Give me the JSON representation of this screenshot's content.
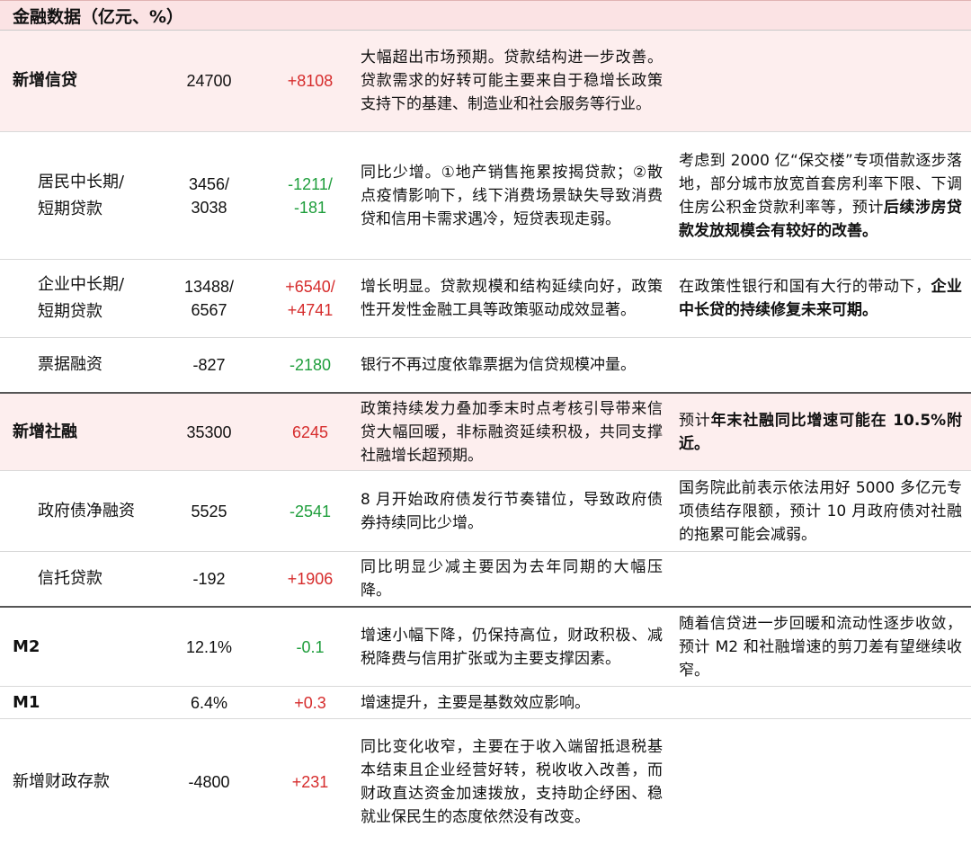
{
  "header": {
    "title": "金融数据（亿元、%）"
  },
  "rows": [
    {
      "name": "新增信贷",
      "value": "24700",
      "change": "+8108",
      "desc": "大幅超出市场预期。贷款结构进一步改善。贷款需求的好转可能主要来自于稳增长政策支持下的基建、制造业和社会服务等行业。",
      "outlook_pre": "",
      "outlook_bold": "",
      "outlook_post": ""
    },
    {
      "name": "居民中长期/短期贷款",
      "value": "3456/3038",
      "change": "-1211/-181",
      "desc": "同比少增。①地产销售拖累按揭贷款；②散点疫情影响下，线下消费场景缺失导致消费贷和信用卡需求遇冷，短贷表现走弱。",
      "outlook_pre": "考虑到 2000 亿“保交楼”专项借款逐步落地，部分城市放宽首套房利率下限、下调住房公积金贷款利率等，预计",
      "outlook_bold": "后续涉房贷款发放规模会有较好的改善。",
      "outlook_post": ""
    },
    {
      "name": "企业中长期/短期贷款",
      "value": "13488/6567",
      "change": "+6540/+4741",
      "desc": "增长明显。贷款规模和结构延续向好，政策性开发性金融工具等政策驱动成效显著。",
      "outlook_pre": "在政策性银行和国有大行的带动下，",
      "outlook_bold": "企业中长贷的持续修复未来可期。",
      "outlook_post": ""
    },
    {
      "name": "票据融资",
      "value": "-827",
      "change": "-2180",
      "desc": "银行不再过度依靠票据为信贷规模冲量。",
      "outlook_pre": "",
      "outlook_bold": "",
      "outlook_post": ""
    },
    {
      "name": "新增社融",
      "value": "35300",
      "change": "6245",
      "desc": "政策持续发力叠加季末时点考核引导带来信贷大幅回暖，非标融资延续积极，共同支撑社融增长超预期。",
      "outlook_pre": "预计",
      "outlook_bold": "年末社融同比增速可能在 10.5%附近。",
      "outlook_post": ""
    },
    {
      "name": "政府债净融资",
      "value": "5525",
      "change": "-2541",
      "desc": "8 月开始政府债发行节奏错位，导致政府债券持续同比少增。",
      "outlook_pre": "国务院此前表示依法用好 5000 多亿元专项债结存限额，预计 10 月政府债对社融的拖累可能会减弱。",
      "outlook_bold": "",
      "outlook_post": ""
    },
    {
      "name": "信托贷款",
      "value": "-192",
      "change": "+1906",
      "desc": "同比明显少减主要因为去年同期的大幅压降。",
      "outlook_pre": "",
      "outlook_bold": "",
      "outlook_post": ""
    },
    {
      "name": "M2",
      "value": "12.1%",
      "change": "-0.1",
      "desc": "增速小幅下降，仍保持高位，财政积极、减税降费与信用扩张或为主要支撑因素。",
      "outlook_pre": "随着信贷进一步回暖和流动性逐步收敛，预计 M2 和社融增速的剪刀差有望继续收窄。",
      "outlook_bold": "",
      "outlook_post": ""
    },
    {
      "name": "M1",
      "value": "6.4%",
      "change": "+0.3",
      "desc": "增速提升，主要是基数效应影响。",
      "outlook_pre": "",
      "outlook_bold": "",
      "outlook_post": ""
    },
    {
      "name": "新增财政存款",
      "value": "-4800",
      "change": "+231",
      "desc": "同比变化收窄，主要在于收入端留抵退税基本结束且企业经营好转，税收收入改善，而财政直达资金加速拨放，支持助企纾困、稳就业保民生的态度依然没有改变。",
      "outlook_pre": "",
      "outlook_bold": "",
      "outlook_post": ""
    }
  ],
  "colors": {
    "up": "#d62c2c",
    "down": "#1f9e3c",
    "header_bg": "#fbe3e4",
    "pink_row": "#fdeeee"
  }
}
